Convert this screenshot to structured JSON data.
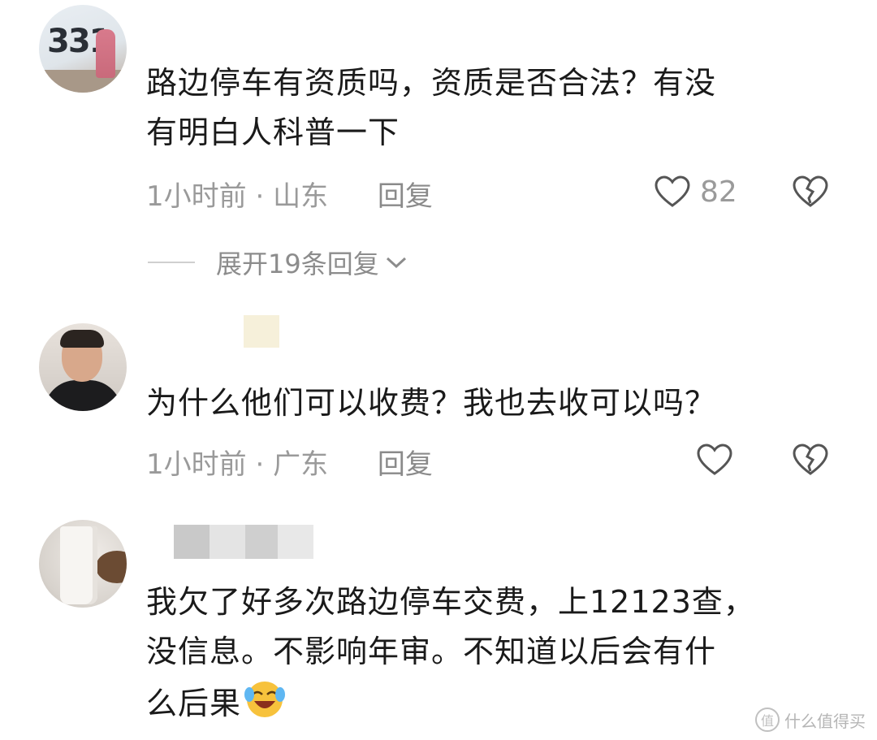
{
  "comments": [
    {
      "avatar_text": "331",
      "text_lines": [
        "路边停车有资质吗，资质是否合法？有没",
        "有明白人科普一下"
      ],
      "time": "1小时前",
      "location": "山东",
      "reply_label": "回复",
      "like_count": "82",
      "expand_label": "展开19条回复"
    },
    {
      "text_lines": [
        "为什么他们可以收费？我也去收可以吗？"
      ],
      "time": "1小时前",
      "location": "广东",
      "reply_label": "回复",
      "like_count": ""
    },
    {
      "text_lines": [
        "我欠了好多次路边停车交费，上12123查，",
        "没信息。不影响年审。不知道以后会有什",
        "么后果"
      ],
      "emoji": "crying-laughing-emoji"
    }
  ],
  "icons": {
    "like": "heart-outline-icon",
    "dislike": "broken-heart-icon",
    "expand": "chevron-down-icon"
  },
  "watermark": {
    "text": "什么值得买"
  },
  "colors": {
    "text": "#1a1a1a",
    "meta": "#9a9a9a"
  }
}
